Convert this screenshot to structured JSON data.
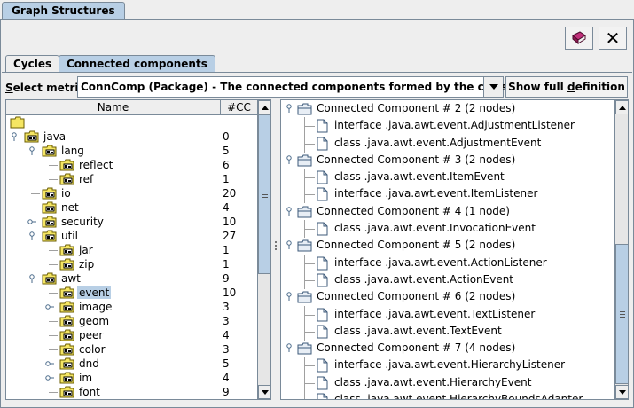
{
  "window": {
    "tab_title": "Graph Structures"
  },
  "toolbar": {
    "book_icon": "book-icon",
    "close_label": "✕"
  },
  "tabs": [
    {
      "label": "Cycles",
      "selected": false
    },
    {
      "label": "Connected components",
      "selected": true
    }
  ],
  "metric": {
    "label_prefix": "S",
    "label_rest": "elect metric:",
    "value": "ConnComp (Package) - The connected components formed by the classes and ...",
    "full_def_pre": "Show full ",
    "full_def_u": "d",
    "full_def_post": "efinition"
  },
  "left_table": {
    "columns": [
      "Name",
      "#CC"
    ],
    "rows": [
      {
        "label": "",
        "cc": "",
        "depth": 0,
        "type": "root",
        "expander": ""
      },
      {
        "label": "java",
        "cc": "0",
        "depth": 0,
        "type": "pkg",
        "expander": "open"
      },
      {
        "label": "lang",
        "cc": "5",
        "depth": 1,
        "type": "pkg",
        "expander": "open"
      },
      {
        "label": "reflect",
        "cc": "6",
        "depth": 2,
        "type": "pkg",
        "expander": ""
      },
      {
        "label": "ref",
        "cc": "1",
        "depth": 2,
        "type": "pkg",
        "expander": ""
      },
      {
        "label": "io",
        "cc": "20",
        "depth": 1,
        "type": "pkg",
        "expander": ""
      },
      {
        "label": "net",
        "cc": "4",
        "depth": 1,
        "type": "pkg",
        "expander": ""
      },
      {
        "label": "security",
        "cc": "10",
        "depth": 1,
        "type": "pkg",
        "expander": "closed"
      },
      {
        "label": "util",
        "cc": "27",
        "depth": 1,
        "type": "pkg",
        "expander": "open"
      },
      {
        "label": "jar",
        "cc": "1",
        "depth": 2,
        "type": "pkg",
        "expander": ""
      },
      {
        "label": "zip",
        "cc": "1",
        "depth": 2,
        "type": "pkg",
        "expander": ""
      },
      {
        "label": "awt",
        "cc": "9",
        "depth": 1,
        "type": "pkg",
        "expander": "open"
      },
      {
        "label": "event",
        "cc": "10",
        "depth": 2,
        "type": "pkg",
        "expander": "",
        "selected": true
      },
      {
        "label": "image",
        "cc": "3",
        "depth": 2,
        "type": "pkg",
        "expander": "closed"
      },
      {
        "label": "geom",
        "cc": "3",
        "depth": 2,
        "type": "pkg",
        "expander": ""
      },
      {
        "label": "peer",
        "cc": "4",
        "depth": 2,
        "type": "pkg",
        "expander": ""
      },
      {
        "label": "color",
        "cc": "3",
        "depth": 2,
        "type": "pkg",
        "expander": ""
      },
      {
        "label": "dnd",
        "cc": "5",
        "depth": 2,
        "type": "pkg",
        "expander": "closed"
      },
      {
        "label": "im",
        "cc": "4",
        "depth": 2,
        "type": "pkg",
        "expander": "closed"
      },
      {
        "label": "font",
        "cc": "9",
        "depth": 2,
        "type": "pkg",
        "expander": ""
      }
    ]
  },
  "right_tree": [
    {
      "label": "Connected Component # 2 (2 nodes)",
      "kind": "comp"
    },
    {
      "label": "interface .java.awt.event.AdjustmentListener",
      "kind": "item"
    },
    {
      "label": "class .java.awt.event.AdjustmentEvent",
      "kind": "item"
    },
    {
      "label": "Connected Component # 3 (2 nodes)",
      "kind": "comp"
    },
    {
      "label": "class .java.awt.event.ItemEvent",
      "kind": "item"
    },
    {
      "label": "interface .java.awt.event.ItemListener",
      "kind": "item"
    },
    {
      "label": "Connected Component # 4 (1 node)",
      "kind": "comp"
    },
    {
      "label": "class .java.awt.event.InvocationEvent",
      "kind": "item"
    },
    {
      "label": "Connected Component # 5 (2 nodes)",
      "kind": "comp"
    },
    {
      "label": "interface .java.awt.event.ActionListener",
      "kind": "item"
    },
    {
      "label": "class .java.awt.event.ActionEvent",
      "kind": "item"
    },
    {
      "label": "Connected Component # 6 (2 nodes)",
      "kind": "comp"
    },
    {
      "label": "interface .java.awt.event.TextListener",
      "kind": "item"
    },
    {
      "label": "class .java.awt.event.TextEvent",
      "kind": "item"
    },
    {
      "label": "Connected Component # 7 (4 nodes)",
      "kind": "comp"
    },
    {
      "label": "interface .java.awt.event.HierarchyListener",
      "kind": "item"
    },
    {
      "label": "class .java.awt.event.HierarchyEvent",
      "kind": "item"
    },
    {
      "label": "class .java.awt.event.HierarchyBoundsAdapter",
      "kind": "item"
    }
  ],
  "colors": {
    "accent": "#b8cfe5",
    "border": "#7a8a99",
    "folder": "#f5e663"
  }
}
